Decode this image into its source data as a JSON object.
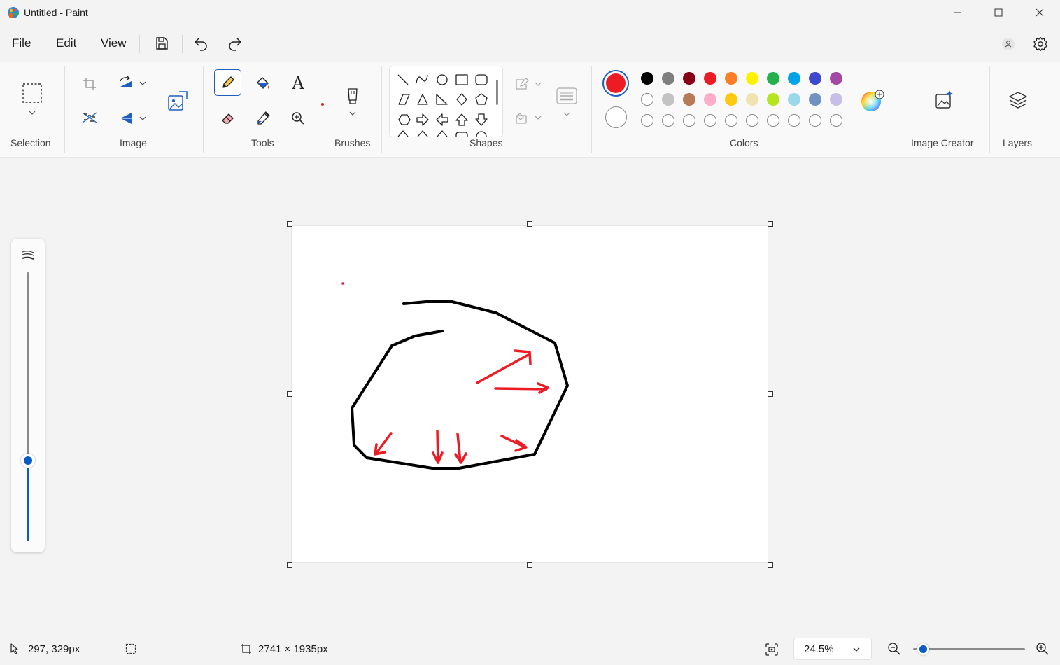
{
  "window": {
    "title": "Untitled - Paint"
  },
  "menu": {
    "file": "File",
    "edit": "Edit",
    "view": "View"
  },
  "ribbon": {
    "groups": {
      "selection": "Selection",
      "image": "Image",
      "tools": "Tools",
      "brushes": "Brushes",
      "shapes": "Shapes",
      "colors": "Colors",
      "image_creator": "Image Creator",
      "layers": "Layers"
    },
    "text_tool_glyph": "A",
    "colors": {
      "primary": "#ed1c24",
      "secondary": "#ffffff",
      "palette_row1": [
        "#000000",
        "#7f7f7f",
        "#880015",
        "#ed1c24",
        "#ff7f27",
        "#fff200",
        "#22b14c",
        "#00a2e8",
        "#3f48cc",
        "#a349a4"
      ],
      "palette_row2": [
        "#ffffff",
        "#c3c3c3",
        "#b97a57",
        "#ffaec9",
        "#ffc90e",
        "#efe4b0",
        "#b5e61d",
        "#99d9ea",
        "#7092be",
        "#c8bfe7"
      ],
      "palette_row3": [
        "",
        "",
        "",
        "",
        "",
        "",
        "",
        "",
        "",
        ""
      ]
    }
  },
  "drawing": {
    "stroke_black": "#000000",
    "stroke_red": "#ed1c24"
  },
  "zoom_slider": {
    "level": 0.3
  },
  "status": {
    "cursor_position": "297, 329px",
    "canvas_size": "2741 × 1935px",
    "zoom": "24.5%",
    "zoom_slider_level": 0.02
  }
}
